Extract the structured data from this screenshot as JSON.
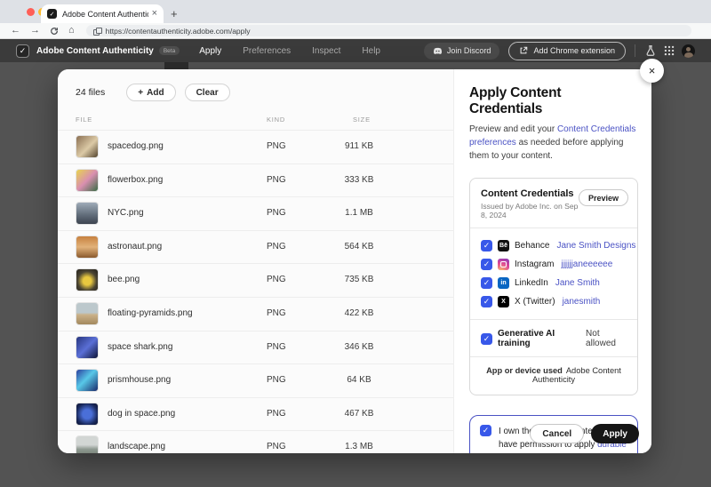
{
  "browser": {
    "tab_title": "Adobe Content Authenticity",
    "url": "https://contentauthenticity.adobe.com/apply"
  },
  "icons": {
    "plus": "+",
    "newtab": "+",
    "tab_close": "×",
    "close": "×",
    "check": "✓",
    "back": "←",
    "forward": "→",
    "home": "⌂",
    "behance": "Bē",
    "linkedin": "in",
    "x": "X",
    "logo_glyph": "✓"
  },
  "app_header": {
    "title": "Adobe Content Authenticity",
    "beta": "Beta",
    "nav": [
      "Apply",
      "Preferences",
      "Inspect",
      "Help"
    ],
    "join_discord": "Join Discord",
    "add_extension": "Add Chrome extension"
  },
  "modal": {
    "files": {
      "count": "24 files",
      "add": "Add",
      "clear": "Clear",
      "columns": [
        "FILE",
        "KIND",
        "SIZE"
      ],
      "rows": [
        {
          "name": "spacedog.png",
          "kind": "PNG",
          "size": "911 KB",
          "thumb": "t1"
        },
        {
          "name": "flowerbox.png",
          "kind": "PNG",
          "size": "333 KB",
          "thumb": "t2"
        },
        {
          "name": "NYC.png",
          "kind": "PNG",
          "size": "1.1 MB",
          "thumb": "t3"
        },
        {
          "name": "astronaut.png",
          "kind": "PNG",
          "size": "564 KB",
          "thumb": "t4"
        },
        {
          "name": "bee.png",
          "kind": "PNG",
          "size": "735 KB",
          "thumb": "t5"
        },
        {
          "name": "floating-pyramids.png",
          "kind": "PNG",
          "size": "422 KB",
          "thumb": "t6"
        },
        {
          "name": "space shark.png",
          "kind": "PNG",
          "size": "346 KB",
          "thumb": "t7"
        },
        {
          "name": "prismhouse.png",
          "kind": "PNG",
          "size": "64 KB",
          "thumb": "t8"
        },
        {
          "name": "dog in space.png",
          "kind": "PNG",
          "size": "467 KB",
          "thumb": "t9"
        },
        {
          "name": "landscape.png",
          "kind": "PNG",
          "size": "1.3 MB",
          "thumb": "t10"
        }
      ]
    },
    "panel": {
      "title": "Apply Content Credentials",
      "desc_before": "Preview and edit your ",
      "desc_link": "Content Credentials preferences",
      "desc_after": " as needed before applying them to your content.",
      "card": {
        "title": "Content Credentials",
        "issued": "Issued by Adobe Inc. on Sep 8, 2024",
        "preview": "Preview",
        "socials": [
          {
            "network": "Behance",
            "handle": "Jane Smith Designs",
            "icon": "behance"
          },
          {
            "network": "Instagram",
            "handle": "jjjjjjaneeeeee",
            "icon": "instagram"
          },
          {
            "network": "LinkedIn",
            "handle": "Jane Smith",
            "icon": "linkedin"
          },
          {
            "network": "X (Twitter)",
            "handle": "janesmith",
            "icon": "x"
          }
        ],
        "genai_label": "Generative AI training",
        "genai_value": "Not allowed",
        "app_used_label": "App or device used",
        "app_used_value": "Adobe Content Authenticity"
      },
      "consent_before": "I own the selected content or have permission to apply ",
      "consent_link": "durable Content Credentials",
      "consent_after": ".",
      "cancel": "Cancel",
      "apply": "Apply"
    }
  },
  "colors": {
    "accent_link": "#4a52c4",
    "checkbox_blue": "#3858e9",
    "apply_button": "#161616",
    "header_bar": "#3b3b3b",
    "backdrop": "#535353"
  }
}
